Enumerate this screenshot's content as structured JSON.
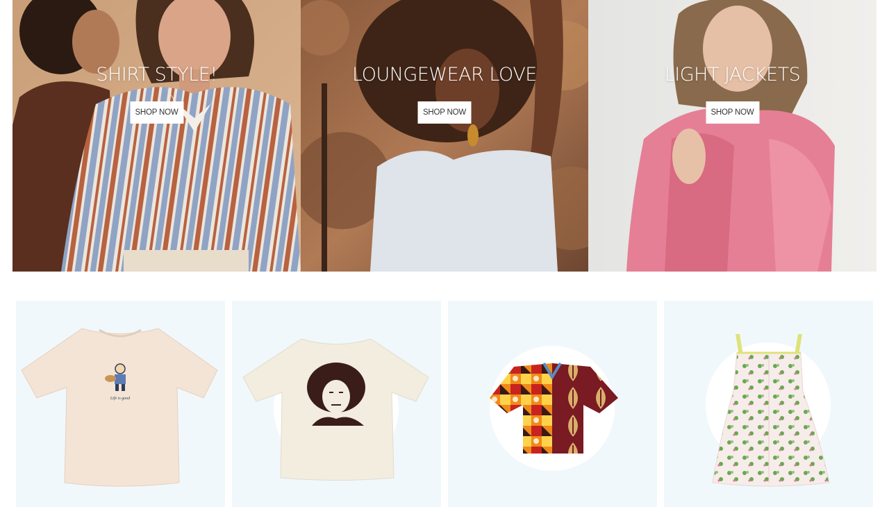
{
  "banners": [
    {
      "title": "SHIRT STYLE!",
      "button_label": "SHOP NOW"
    },
    {
      "title": "LOUNGEWEAR LOVE",
      "button_label": "SHOP NOW"
    },
    {
      "title": "LIGHT JACKETS",
      "button_label": "SHOP NOW"
    }
  ],
  "products": [
    {
      "image": "cream-graphic-tee",
      "print_text": "Life is good"
    },
    {
      "image": "portrait-graphic-tee"
    },
    {
      "image": "patterned-short-sleeve-shirt"
    },
    {
      "image": "floral-sundress"
    }
  ],
  "colors": {
    "card_background": "#f1f8fc",
    "button_background": "#ffffff",
    "banner_text": "#ffffff"
  }
}
